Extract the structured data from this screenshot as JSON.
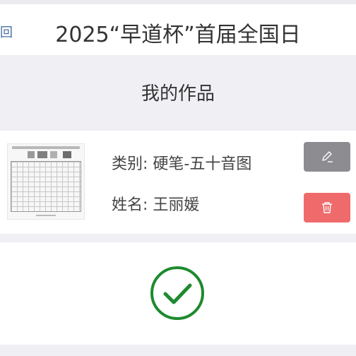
{
  "nav": {
    "back_label": "返回",
    "title": "2025“早道杯”首届全国日"
  },
  "section": {
    "title": "我的作品"
  },
  "work": {
    "category_label": "类别: ",
    "category_value": "硬笔-五十音图",
    "name_label": "姓名: ",
    "name_value": "王丽媛",
    "thumbnail_icon": "handwriting-sheet-thumbnail",
    "edit_icon": "pencil-icon",
    "delete_icon": "trash-icon"
  },
  "status": {
    "icon": "checkmark-circle-icon"
  },
  "colors": {
    "edit_button": "#8d8d91",
    "delete_button": "#ef6b6b",
    "check": "#1e8a2e",
    "back_link": "#4a6fa5"
  }
}
